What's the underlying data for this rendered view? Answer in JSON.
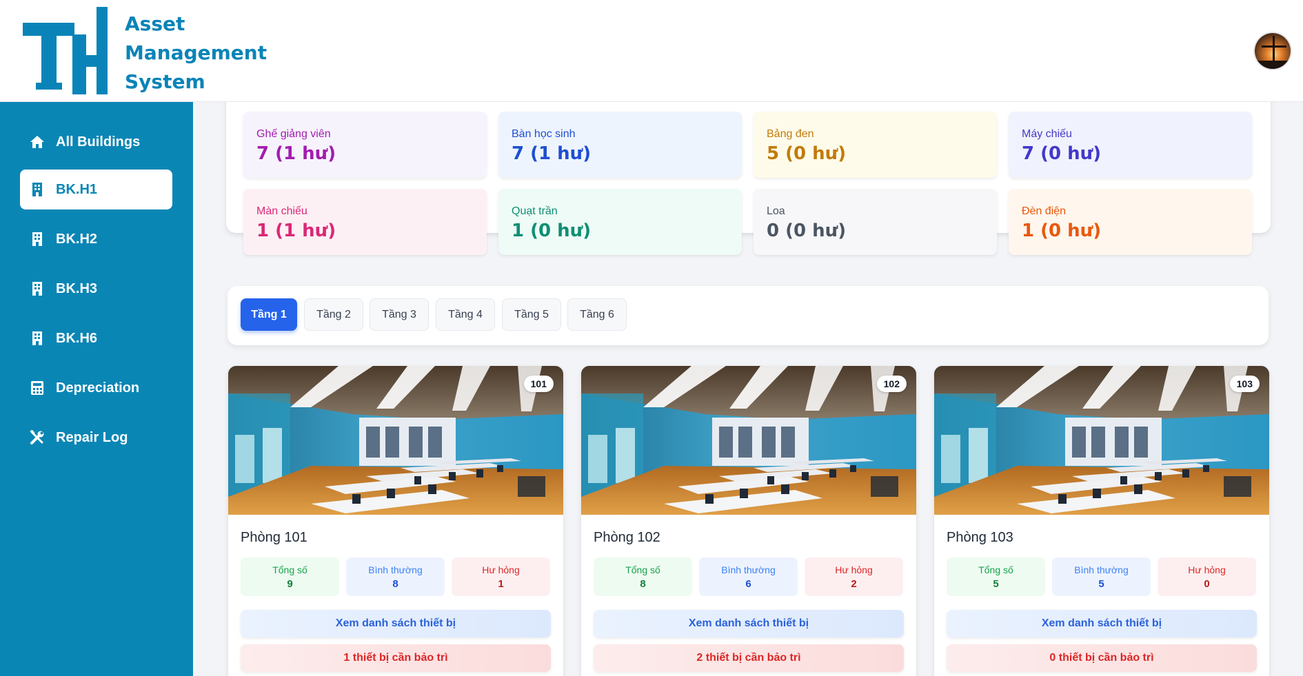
{
  "app": {
    "logo_lines": [
      "Asset",
      "Management",
      "System"
    ],
    "colors": {
      "brand": "#0a86b5",
      "accent": "#2563eb",
      "danger": "#dc2626"
    }
  },
  "sidebar": {
    "items": [
      {
        "label": "All Buildings",
        "icon": "home-icon",
        "active": false
      },
      {
        "label": "BK.H1",
        "icon": "building-icon",
        "active": true
      },
      {
        "label": "BK.H2",
        "icon": "building-icon",
        "active": false
      },
      {
        "label": "BK.H3",
        "icon": "building-icon",
        "active": false
      },
      {
        "label": "BK.H6",
        "icon": "building-icon",
        "active": false
      },
      {
        "label": "Depreciation",
        "icon": "calculator-icon",
        "active": false
      },
      {
        "label": "Repair Log",
        "icon": "tools-icon",
        "active": false
      }
    ]
  },
  "summary": {
    "cards": [
      {
        "label": "Ghế giảng viên",
        "value": "7 (1 hư)",
        "color": "#a21caf",
        "bg": "#f7f3fd"
      },
      {
        "label": "Bàn học sinh",
        "value": "7 (1 hư)",
        "color": "#1e4fd1",
        "bg": "#eef4fd"
      },
      {
        "label": "Bảng đen",
        "value": "5 (0 hư)",
        "color": "#c27b0a",
        "bg": "#fefbea"
      },
      {
        "label": "Máy chiếu",
        "value": "7 (0 hư)",
        "color": "#4338ca",
        "bg": "#f0f2fd"
      },
      {
        "label": "Màn chiếu",
        "value": "1 (1 hư)",
        "color": "#db2777",
        "bg": "#fdf0f4"
      },
      {
        "label": "Quạt trần",
        "value": "1 (0 hư)",
        "color": "#0f8f74",
        "bg": "#eefbf6"
      },
      {
        "label": "Loa",
        "value": "0 (0 hư)",
        "color": "#4b5563",
        "bg": "#f7f7f9"
      },
      {
        "label": "Đèn điện",
        "value": "1 (0 hư)",
        "color": "#ea580c",
        "bg": "#fff6ed"
      }
    ]
  },
  "floors": {
    "tabs": [
      "Tầng 1",
      "Tầng 2",
      "Tầng 3",
      "Tầng 4",
      "Tầng 5",
      "Tầng 6"
    ],
    "active": "Tầng 1"
  },
  "rooms": [
    {
      "badge": "101",
      "name": "Phòng 101",
      "stats": [
        {
          "label": "Tổng số",
          "value": "9"
        },
        {
          "label": "Bình thường",
          "value": "8"
        },
        {
          "label": "Hư hỏng",
          "value": "1"
        }
      ],
      "list_button": "Xem danh sách thiết bị",
      "maintenance_button": "1 thiết bị cần bảo trì"
    },
    {
      "badge": "102",
      "name": "Phòng 102",
      "stats": [
        {
          "label": "Tổng số",
          "value": "8"
        },
        {
          "label": "Bình thường",
          "value": "6"
        },
        {
          "label": "Hư hỏng",
          "value": "2"
        }
      ],
      "list_button": "Xem danh sách thiết bị",
      "maintenance_button": "2 thiết bị cần bảo trì"
    },
    {
      "badge": "103",
      "name": "Phòng 103",
      "stats": [
        {
          "label": "Tổng số",
          "value": "5"
        },
        {
          "label": "Bình thường",
          "value": "5"
        },
        {
          "label": "Hư hỏng",
          "value": "0"
        }
      ],
      "list_button": "Xem danh sách thiết bị",
      "maintenance_button": "0 thiết bị cần bảo trì"
    }
  ]
}
